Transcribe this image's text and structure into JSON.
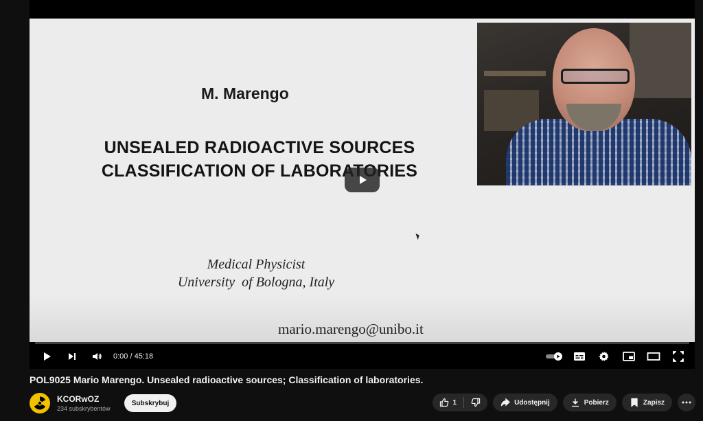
{
  "slide": {
    "author": "M. Marengo",
    "title_line1": "UNSEALED RADIOACTIVE SOURCES",
    "title_line2": "CLASSIFICATION OF LABORATORIES",
    "role_line1": "Medical Physicist",
    "role_line2": "University  of Bologna, Italy",
    "email": "mario.marengo@unibo.it"
  },
  "player": {
    "current_time": "0:00",
    "separator": " / ",
    "duration": "45:18",
    "progress_fraction": 0
  },
  "video": {
    "title": "POL9025 Mario Marengo. Unsealed radioactive sources; Classification of laboratories."
  },
  "channel": {
    "name": "KCORwOZ",
    "subscribers": "234 subskrybentów",
    "subscribe_label": "Subskrybuj"
  },
  "actions": {
    "like_count": "1",
    "share_label": "Udostępnij",
    "download_label": "Pobierz",
    "save_label": "Zapisz"
  },
  "colors": {
    "background": "#0f0f0f",
    "pill": "#272727",
    "avatar": "#f2c200"
  }
}
